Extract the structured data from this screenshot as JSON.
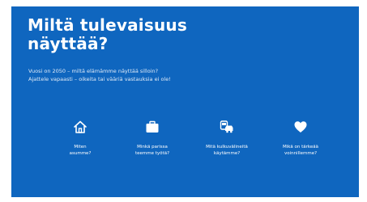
{
  "slide": {
    "title": "Miltä tulevaisuus näyttää?",
    "intro_line1": "Vuosi on 2050 – miltä elämämme näyttää silloin?",
    "intro_line2": "Ajattele vapaasti – oikeita tai vääriä vastauksia ei ole!"
  },
  "colors": {
    "panel_background": "#0f66bf",
    "text": "#ffffff"
  },
  "topics": [
    {
      "icon": "home-icon",
      "label": "Miten\nasumme?"
    },
    {
      "icon": "briefcase-icon",
      "label": "Minkä parissa\nteemme työtä?"
    },
    {
      "icon": "vehicles-icon",
      "label": "Mitä kulkuvälineitä\nkäytämme?"
    },
    {
      "icon": "heart-icon",
      "label": "Mikä on tärkeää\nvoinnillemme?"
    }
  ]
}
